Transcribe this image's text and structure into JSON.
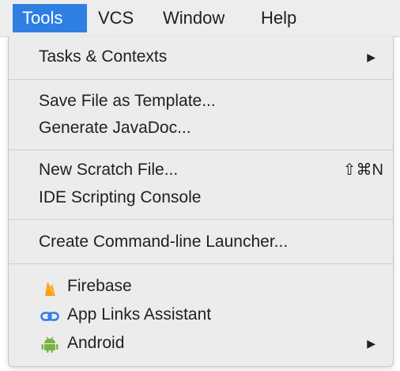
{
  "menubar": {
    "items": [
      {
        "label": "Tools",
        "active": true
      },
      {
        "label": "VCS"
      },
      {
        "label": "Window"
      },
      {
        "label": "Help"
      }
    ]
  },
  "dropdown": {
    "groups": [
      [
        {
          "label": "Tasks & Contexts",
          "submenu": true
        }
      ],
      [
        {
          "label": "Save File as Template..."
        },
        {
          "label": "Generate JavaDoc..."
        }
      ],
      [
        {
          "label": "New Scratch File...",
          "shortcut": "⇧⌘N"
        },
        {
          "label": "IDE Scripting Console"
        }
      ],
      [
        {
          "label": "Create Command-line Launcher..."
        }
      ],
      [
        {
          "label": "Firebase",
          "icon": "firebase-icon"
        },
        {
          "label": "App Links Assistant",
          "icon": "link-icon"
        },
        {
          "label": "Android",
          "icon": "android-icon",
          "submenu": true
        }
      ]
    ],
    "submenu_arrow": "▶"
  },
  "colors": {
    "active_menu": "#2f7fe3",
    "menu_bg": "#ececec",
    "firebase": "#f5a623",
    "link": "#2f7fe3",
    "android": "#7cb342"
  }
}
